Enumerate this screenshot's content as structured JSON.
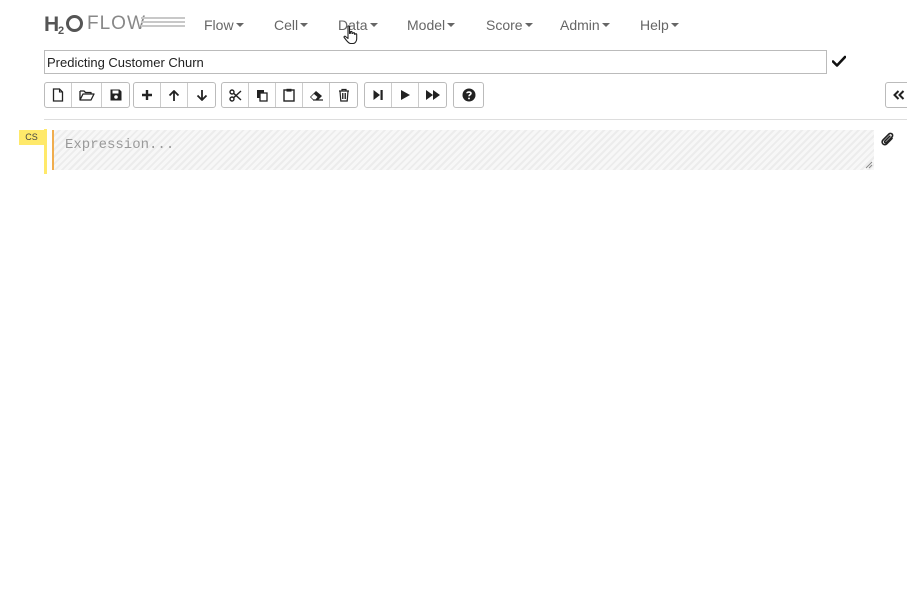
{
  "logo": {
    "h": "H",
    "sub": "2",
    "flow": "FLOW"
  },
  "menu": [
    {
      "label": "Flow"
    },
    {
      "label": "Cell"
    },
    {
      "label": "Data"
    },
    {
      "label": "Model"
    },
    {
      "label": "Score"
    },
    {
      "label": "Admin"
    },
    {
      "label": "Help"
    }
  ],
  "notebook": {
    "title": "Predicting Customer Churn"
  },
  "toolbar": {
    "groups": [
      [
        "new-file-icon",
        "open-folder-icon",
        "save-icon"
      ],
      [
        "plus-icon",
        "arrow-up-icon",
        "arrow-down-icon"
      ],
      [
        "scissors-icon",
        "copy-icon",
        "clipboard-icon",
        "eraser-icon",
        "trash-icon"
      ],
      [
        "step-forward-icon",
        "play-icon",
        "fast-forward-icon"
      ],
      [
        "help-icon"
      ]
    ]
  },
  "cell": {
    "type": "CS",
    "placeholder": "Expression..."
  },
  "colors": {
    "cell_type_bg": "#ffe96a",
    "editor_border": "#f0ad4e",
    "menu_text": "#666666"
  }
}
